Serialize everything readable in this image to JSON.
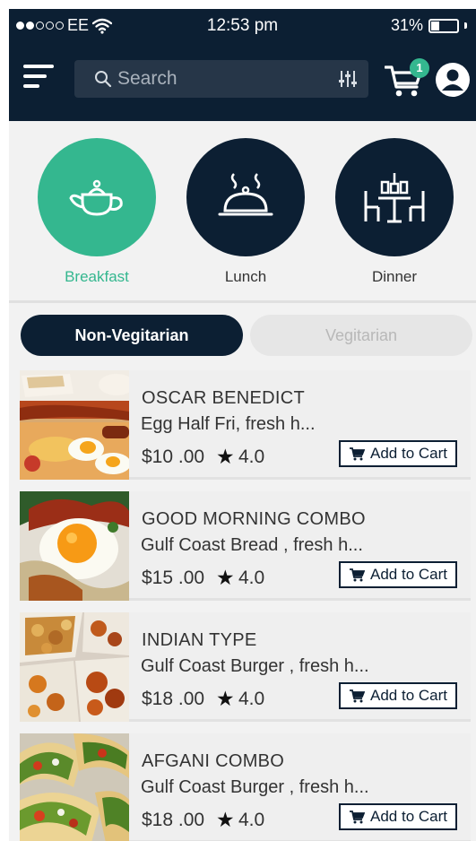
{
  "status_bar": {
    "carrier": "EE",
    "time": "12:53 pm",
    "battery": "31%",
    "battery_level": 0.31
  },
  "header": {
    "search_placeholder": "Search",
    "cart_count": "1"
  },
  "categories": [
    {
      "label": "Breakfast",
      "icon": "teapot-icon",
      "active": true
    },
    {
      "label": "Lunch",
      "icon": "cloche-icon",
      "active": false
    },
    {
      "label": "Dinner",
      "icon": "dining-table-icon",
      "active": false
    }
  ],
  "toggle": {
    "selected": "Non-Vegitarian",
    "unselected": "Vegitarian"
  },
  "items": [
    {
      "name": "OSCAR BENEDICT",
      "description": "Egg Half Fri, fresh h...",
      "price": "$10 .00",
      "rating": "4.0",
      "button": "Add to Cart"
    },
    {
      "name": "GOOD MORNING COMBO",
      "description": "Gulf Coast Bread , fresh h...",
      "price": "$15 .00",
      "rating": "4.0",
      "button": "Add to Cart"
    },
    {
      "name": "INDIAN TYPE",
      "description": "Gulf Coast Burger , fresh h...",
      "price": "$18 .00",
      "rating": "4.0",
      "button": "Add to Cart"
    },
    {
      "name": "AFGANI COMBO",
      "description": "Gulf Coast Burger , fresh h...",
      "price": "$18 .00",
      "rating": "4.0",
      "button": "Add to Cart"
    }
  ],
  "colors": {
    "navy": "#0c1f33",
    "accent": "#34b78f"
  }
}
